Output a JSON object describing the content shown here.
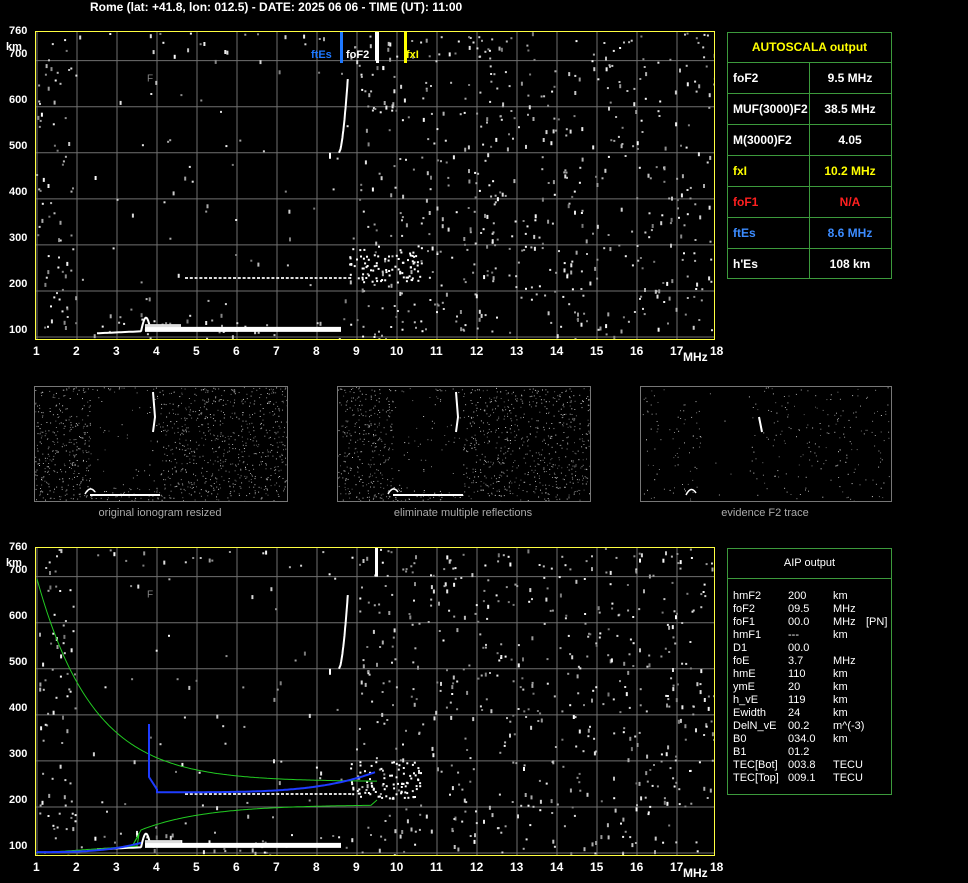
{
  "header": {
    "title": "Rome (lat: +41.8, lon: 012.5) - DATE: 2025 06 06 - TIME (UT): 11:00"
  },
  "axes": {
    "y_unit": "km",
    "x_unit": "MHz",
    "y_ticks": [
      "760",
      "700",
      "600",
      "500",
      "400",
      "300",
      "200",
      "100"
    ],
    "x_ticks": [
      "1",
      "2",
      "3",
      "4",
      "5",
      "6",
      "7",
      "8",
      "9",
      "10",
      "11",
      "12",
      "13",
      "14",
      "15",
      "16",
      "17",
      "18"
    ]
  },
  "top_plot": {
    "markers": [
      {
        "label": "ftEs",
        "color": "#1e78ff"
      },
      {
        "label": "foF2",
        "color": "#ffffff"
      },
      {
        "label": "fxI",
        "color": "#ffff00"
      }
    ]
  },
  "autoscala": {
    "title": "AUTOSCALA output",
    "rows": [
      {
        "key": "foF2",
        "value": "9.5 MHz",
        "color": "#ffffff"
      },
      {
        "key": "MUF(3000)F2",
        "value": "38.5 MHz",
        "color": "#ffffff"
      },
      {
        "key": "M(3000)F2",
        "value": "4.05",
        "color": "#ffffff"
      },
      {
        "key": "fxI",
        "value": "10.2 MHz",
        "color": "#ffff00"
      },
      {
        "key": "foF1",
        "value": "N/A",
        "color": "#ff2020"
      },
      {
        "key": "ftEs",
        "value": "8.6 MHz",
        "color": "#3c8cff"
      },
      {
        "key": "h'Es",
        "value": "108     km",
        "color": "#ffffff"
      }
    ]
  },
  "mini_panels": [
    {
      "caption": "original ionogram resized"
    },
    {
      "caption": "eliminate multiple reflections"
    },
    {
      "caption": "evidence F2 trace"
    }
  ],
  "aip": {
    "title": "AIP output",
    "rows": [
      {
        "name": "hmF2",
        "value": "200",
        "unit": "km",
        "extra": ""
      },
      {
        "name": "foF2",
        "value": "09.5",
        "unit": "MHz",
        "extra": ""
      },
      {
        "name": "foF1",
        "value": "00.0",
        "unit": "MHz",
        "extra": "[PN]"
      },
      {
        "name": "hmF1",
        "value": "---",
        "unit": "km",
        "extra": ""
      },
      {
        "name": "D1",
        "value": "00.0",
        "unit": "",
        "extra": ""
      },
      {
        "name": "foE",
        "value": "3.7",
        "unit": "MHz",
        "extra": ""
      },
      {
        "name": "hmE",
        "value": "110",
        "unit": "km",
        "extra": ""
      },
      {
        "name": "ymE",
        "value": "20",
        "unit": "km",
        "extra": ""
      },
      {
        "name": "h_vE",
        "value": "119",
        "unit": "km",
        "extra": ""
      },
      {
        "name": "Ewidth",
        "value": "24",
        "unit": "km",
        "extra": ""
      },
      {
        "name": "DelN_vE",
        "value": "00.2",
        "unit": "m^(-3)",
        "extra": ""
      },
      {
        "name": "B0",
        "value": "034.0",
        "unit": "km",
        "extra": ""
      },
      {
        "name": "B1",
        "value": "01.2",
        "unit": "",
        "extra": ""
      },
      {
        "name": "TEC[Bot]",
        "value": "003.8",
        "unit": "TECU",
        "extra": ""
      },
      {
        "name": "TEC[Top]",
        "value": "009.1",
        "unit": "TECU",
        "extra": ""
      }
    ]
  },
  "colors": {
    "frame": "#ffff40",
    "panel_border": "#3c9a3c",
    "grid": "#707070",
    "trace": "#ffffff",
    "profile_blue": "#1e3cff",
    "profile_green": "#22cc22"
  }
}
